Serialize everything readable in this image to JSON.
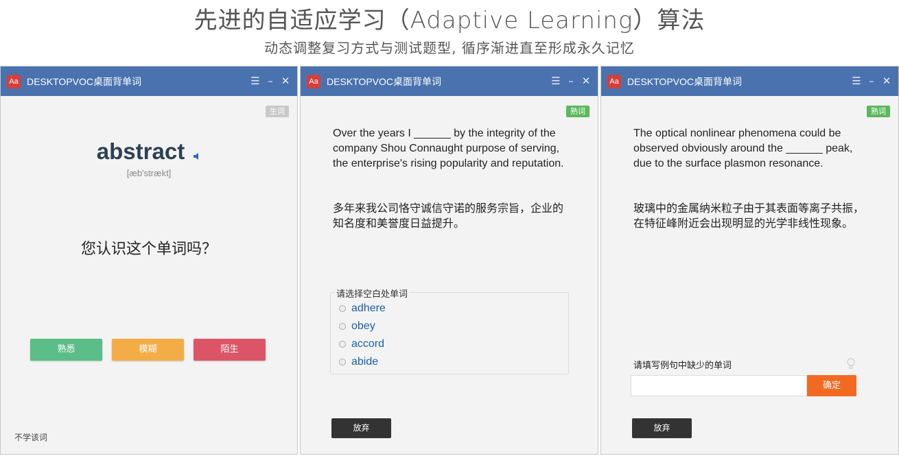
{
  "header": {
    "headline": "先进的自适应学习（Adaptive Learning）算法",
    "subhead": "动态调整复习方式与测试题型, 循序渐进直至形成永久记忆"
  },
  "app": {
    "logo_text": "Aa",
    "title": "DESKTOPVOC桌面背单词",
    "logo_color": "#d43f3a",
    "titlebar_color": "#4a72ae"
  },
  "window1": {
    "tag": "生词",
    "word": "abstract",
    "phonetic": "[æb'strækt]",
    "question": "您认识这个单词吗？",
    "buttons": {
      "familiar": "熟悉",
      "vague": "模糊",
      "unknown": "陌生"
    },
    "skip": "不学该词"
  },
  "window2": {
    "tag": "熟词",
    "sentence": "Over the years I ______ by the integrity of the company Shou Connaught purpose of serving, the enterprise's rising popularity and reputation.",
    "translation": "多年来我公司恪守诚信守诺的服务宗旨，企业的知名度和美誉度日益提升。",
    "legend": "请选择空白处单词",
    "options": [
      "adhere",
      "obey",
      "accord",
      "abide"
    ],
    "giveup": "放弃"
  },
  "window3": {
    "tag": "熟词",
    "sentence": "The optical nonlinear phenomena could be observed obviously around the ______ peak, due to the surface plasmon resonance.",
    "translation": "玻璃中的金属纳米粒子由于其表面等离子共振，在特征峰附近会出现明显的光学非线性现象。",
    "fill_label": "请填写例句中缺少的单词",
    "input_value": "",
    "confirm": "确定",
    "giveup": "放弃"
  },
  "titlebar_icons": [
    "menu-icon",
    "minimize-icon",
    "close-icon"
  ]
}
